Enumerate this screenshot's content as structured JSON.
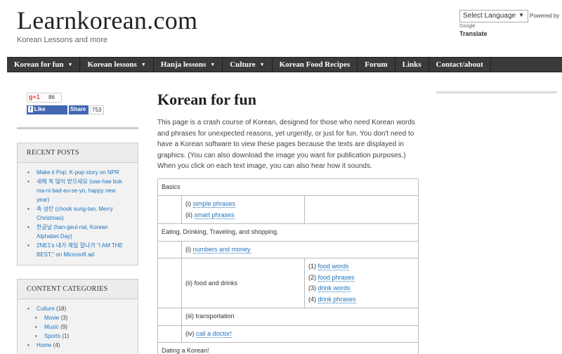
{
  "header": {
    "site_title": "Learnkorean.com",
    "tagline": "Korean Lessons and more",
    "language_select": "Select Language",
    "powered_by": "Powered by",
    "google": "Google",
    "translate": "Translate"
  },
  "nav": [
    {
      "label": "Korean for fun",
      "dropdown": true
    },
    {
      "label": "Korean lessons",
      "dropdown": true
    },
    {
      "label": "Hanja lessons",
      "dropdown": true
    },
    {
      "label": "Culture",
      "dropdown": true
    },
    {
      "label": "Korean Food Recipes",
      "dropdown": false
    },
    {
      "label": "Forum",
      "dropdown": false
    },
    {
      "label": "Links",
      "dropdown": false
    },
    {
      "label": "Contact/about",
      "dropdown": false
    }
  ],
  "social": {
    "gplus_label": "+1",
    "gplus_count": "86",
    "fb_like": "Like",
    "fb_share": "Share",
    "fb_count": "753"
  },
  "sidebar": {
    "recent_posts_title": "RECENT POSTS",
    "recent_posts": [
      "Make it Pop: K-pop story on NPR",
      "새해 복 많이 받으세요 (sae-hae bok ma-ni bad-eu-se-yo, happy new year)",
      "축 성탄 (chook sung-tan, Merry Christmas)",
      "한글날 (han-geul-nal, Korean Alphabet Day)",
      "2NE1's 내가 제일 잘나가 \"I AM THE BEST,\" on Microsoft ad"
    ],
    "categories_title": "CONTENT CATEGORIES",
    "categories": [
      {
        "name": "Culture",
        "count": "(18)",
        "sub": false
      },
      {
        "name": "Movie",
        "count": "(3)",
        "sub": true
      },
      {
        "name": "Music",
        "count": "(9)",
        "sub": true
      },
      {
        "name": "Sports",
        "count": "(1)",
        "sub": true
      },
      {
        "name": "Home",
        "count": "(4)",
        "sub": false
      }
    ]
  },
  "main": {
    "title": "Korean for fun",
    "intro": "This page is a crash course of Korean, designed for those who need Korean words and phrases for unexpected reasons, yet urgently, or just for fun. You don't need to have a Korean software to view these pages because the texts are displayed in graphics. (You can also download the image you want for publication purposes.) When you click on each text image, you can also hear how it sounds.",
    "table": {
      "basics": "Basics",
      "basics_prefix_1": "(i) ",
      "simple_phrases": "simple phrases",
      "basics_prefix_2": "(ii) ",
      "smart_phrases": "smart phrases",
      "eating_section": "Eating, Drinking, Traveling, and shopping.",
      "numbers_prefix": "(i) ",
      "numbers_money": "numbers and money",
      "food_drinks": "(ii) food and drinks",
      "food_links": [
        {
          "prefix": "(1) ",
          "label": "food words"
        },
        {
          "prefix": "(2) ",
          "label": "food phrases"
        },
        {
          "prefix": "(3) ",
          "label": "drink words"
        },
        {
          "prefix": "(4) ",
          "label": "drink phrases"
        }
      ],
      "transportation": "(iii) transportation",
      "doctor_prefix": "(iv) ",
      "call_doctor": "call a doctor!",
      "dating": "Dating a Korean!"
    }
  }
}
